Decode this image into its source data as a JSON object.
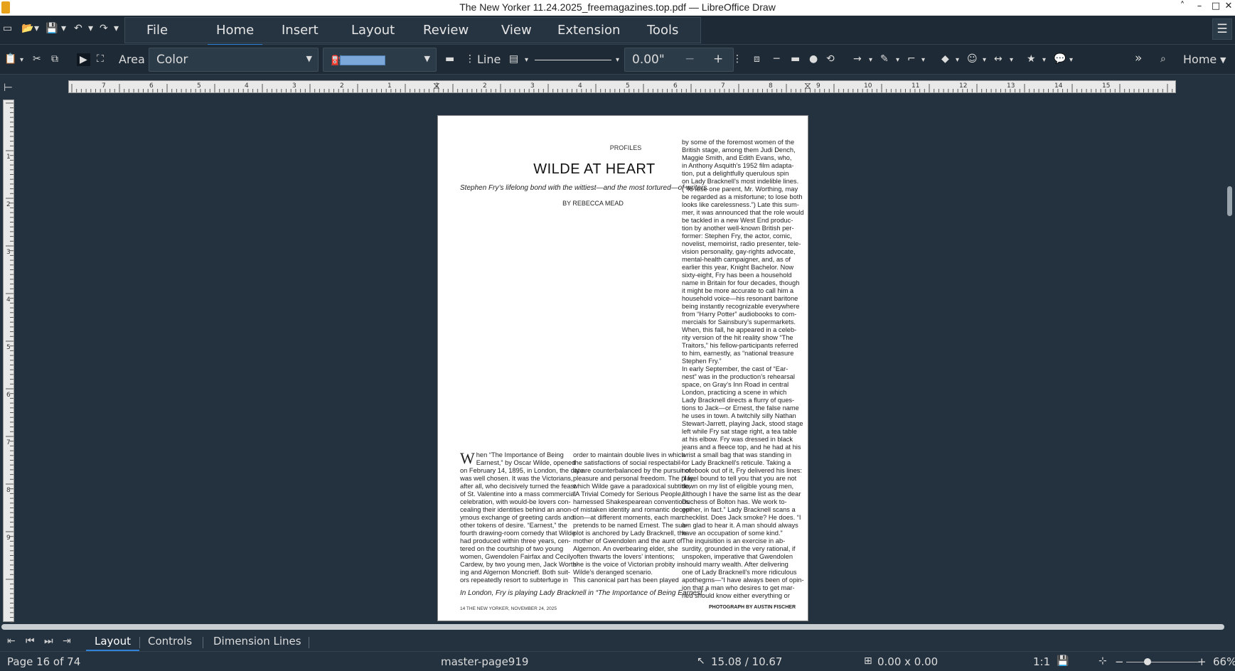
{
  "window": {
    "title": "The New Yorker 11.24.2025_freemagazines.top.pdf — LibreOffice Draw",
    "controls": [
      "˄",
      "–",
      "□",
      "✕"
    ]
  },
  "quick_access": {
    "icons": [
      "new-document-icon",
      "open-icon",
      "save-icon",
      "undo-icon",
      "redo-icon"
    ],
    "glyphs": {
      "new": "▭",
      "open": "📂",
      "save": "💾",
      "undo": "↶",
      "redo": "↷",
      "dropdown": "▾"
    }
  },
  "menu_tabs": [
    {
      "label": "File"
    },
    {
      "label": "Home",
      "active": true
    },
    {
      "label": "Insert"
    },
    {
      "label": "Layout"
    },
    {
      "label": "Review"
    },
    {
      "label": "View"
    },
    {
      "label": "Extension"
    },
    {
      "label": "Tools"
    }
  ],
  "toolbar": {
    "area_label": "Area",
    "area_fill": "Color",
    "fill_color": "#7ba7d9",
    "line_label": "Line",
    "line_width": "0.00\"",
    "minus": "−",
    "plus": "+",
    "overflow": "»",
    "home_label": "Home",
    "more": "⋮"
  },
  "ruler": {
    "horizontal": [
      "7",
      "6",
      "5",
      "4",
      "3",
      "2",
      "1",
      "1",
      "2",
      "3",
      "4",
      "5",
      "6",
      "7",
      "8",
      "9",
      "10",
      "11",
      "12",
      "13",
      "14",
      "15"
    ],
    "vertical": [
      "1",
      "2",
      "3",
      "4",
      "5",
      "6",
      "7",
      "8",
      "9"
    ]
  },
  "page": {
    "section": "PROFILES",
    "title": "WILDE AT HEART",
    "dek": "Stephen Fry’s lifelong bond with the wittiest—and the most tortured—of writers.",
    "byline": "BY REBECCA MEAD",
    "col1_dropcap": "W",
    "col1_lines": [
      "hen “The Importance of Being",
      "Earnest,” by Oscar Wilde, opened",
      "on February 14, 1895, in London, the date",
      "was well chosen. It was the Victorians,",
      "after all, who decisively turned the feast",
      "of St. Valentine into a mass commercial",
      "celebration, with would-be lovers con-",
      "cealing their identities behind an anon-",
      "ymous exchange of greeting cards and",
      "other tokens of desire. “Earnest,” the",
      "fourth drawing-room comedy that Wilde",
      "had produced within three years, cen-",
      "tered on the courtship of two young",
      "women, Gwendolen Fairfax and Cecily",
      "Cardew, by two young men, Jack Worth-",
      "ing and Algernon Moncrieff. Both suit-",
      "ors repeatedly resort to subterfuge in"
    ],
    "col2_lines": [
      "order to maintain double lives in which",
      "the satisfactions of social respectabil-",
      "ity are counterbalanced by the pursuit of",
      "pleasure and personal freedom. The play,",
      "which Wilde gave a paradoxical subtitle,",
      "“A Trivial Comedy for Serious People,”",
      "harnessed Shakespearean conventions",
      "of mistaken identity and romantic decep-",
      "tion—at different moments, each man",
      "pretends to be named Ernest. The sub-",
      "plot is anchored by Lady Bracknell, the",
      "mother of Gwendolen and the aunt of",
      "Algernon. An overbearing elder, she",
      "often thwarts the lovers’ intentions;",
      "she is the voice of Victorian probity in",
      "Wilde’s deranged scenario.",
      "This canonical part has been played"
    ],
    "col3_lines": [
      "by some of the foremost women of the",
      "British stage, among them Judi Dench,",
      "Maggie Smith, and Edith Evans, who,",
      "in Anthony Asquith’s 1952 film adapta-",
      "tion, put a delightfully querulous spin",
      "on Lady Bracknell’s most indelible lines.",
      "(“To lose one parent, Mr. Worthing, may",
      "be regarded as a misfortune; to lose both",
      "looks like carelessness.”) Late this sum-",
      "mer, it was announced that the role would",
      "be tackled in a new West End produc-",
      "tion by another well-known British per-",
      "former: Stephen Fry, the actor, comic,",
      "novelist, memoirist, radio presenter, tele-",
      "vision personality, gay-rights advocate,",
      "mental-health campaigner, and, as of",
      "earlier this year, Knight Bachelor. Now",
      "sixty-eight, Fry has been a household",
      "name in Britain for four decades, though",
      "it might be more accurate to call him a",
      "household voice—his resonant baritone",
      "being instantly recognizable everywhere",
      "from “Harry Potter” audiobooks to com-",
      "mercials for Sainsbury’s supermarkets.",
      "When, this fall, he appeared in a celeb-",
      "rity version of the hit reality show “The",
      "Traitors,” his fellow-participants referred",
      "to him, earnestly, as “national treasure",
      "Stephen Fry.”",
      "   In early September, the cast of “Ear-",
      "nest” was in the production’s rehearsal",
      "space, on Gray’s Inn Road in central",
      "London, practicing a scene in which",
      "Lady Bracknell directs a flurry of ques-",
      "tions to Jack—or Ernest, the false name",
      "he uses in town. A twitchily silly Nathan",
      "Stewart-Jarrett, playing Jack, stood stage",
      "left while Fry sat stage right, a tea table",
      "at his elbow. Fry was dressed in black",
      "jeans and a fleece top, and he had at his",
      "wrist a small bag that was standing in",
      "for Lady Bracknell’s reticule. Taking a",
      "notebook out of it, Fry delivered his lines:",
      "“I feel bound to tell you that you are not",
      "down on my list of eligible young men,",
      "although I have the same list as the dear",
      "Duchess of Bolton has. We work to-",
      "gether, in fact.” Lady Bracknell scans a",
      "checklist. Does Jack smoke? He does. “I",
      "am glad to hear it. A man should always",
      "have an occupation of some kind.”",
      "   The inquisition is an exercise in ab-",
      "surdity, grounded in the very rational, if",
      "unspoken, imperative that Gwendolen",
      "should marry wealth. After delivering",
      "one of Lady Bracknell’s more ridiculous",
      "apothegms—“I have always been of opin-",
      "ion that a man who desires to get mar-",
      "ried should know either everything or"
    ],
    "caption": "In London, Fry is playing Lady Bracknell in “The Importance of Being Earnest.”",
    "folio": "14     THE NEW YORKER, NOVEMBER 24, 2025",
    "credit": "PHOTOGRAPH BY AUSTIN FISCHER"
  },
  "layer_tabs": [
    {
      "label": "Layout",
      "active": true
    },
    {
      "label": "Controls"
    },
    {
      "label": "Dimension Lines"
    }
  ],
  "layer_nav": [
    "⇤",
    "⏮",
    "⏭",
    "⇥"
  ],
  "status": {
    "page": "Page 16 of 74",
    "master": "master-page919",
    "position": "15.08 / 10.67",
    "size": "0.00 x 0.00",
    "scale": "1:1",
    "zoom": "66%",
    "zoom_minus": "−",
    "zoom_plus": "+"
  }
}
